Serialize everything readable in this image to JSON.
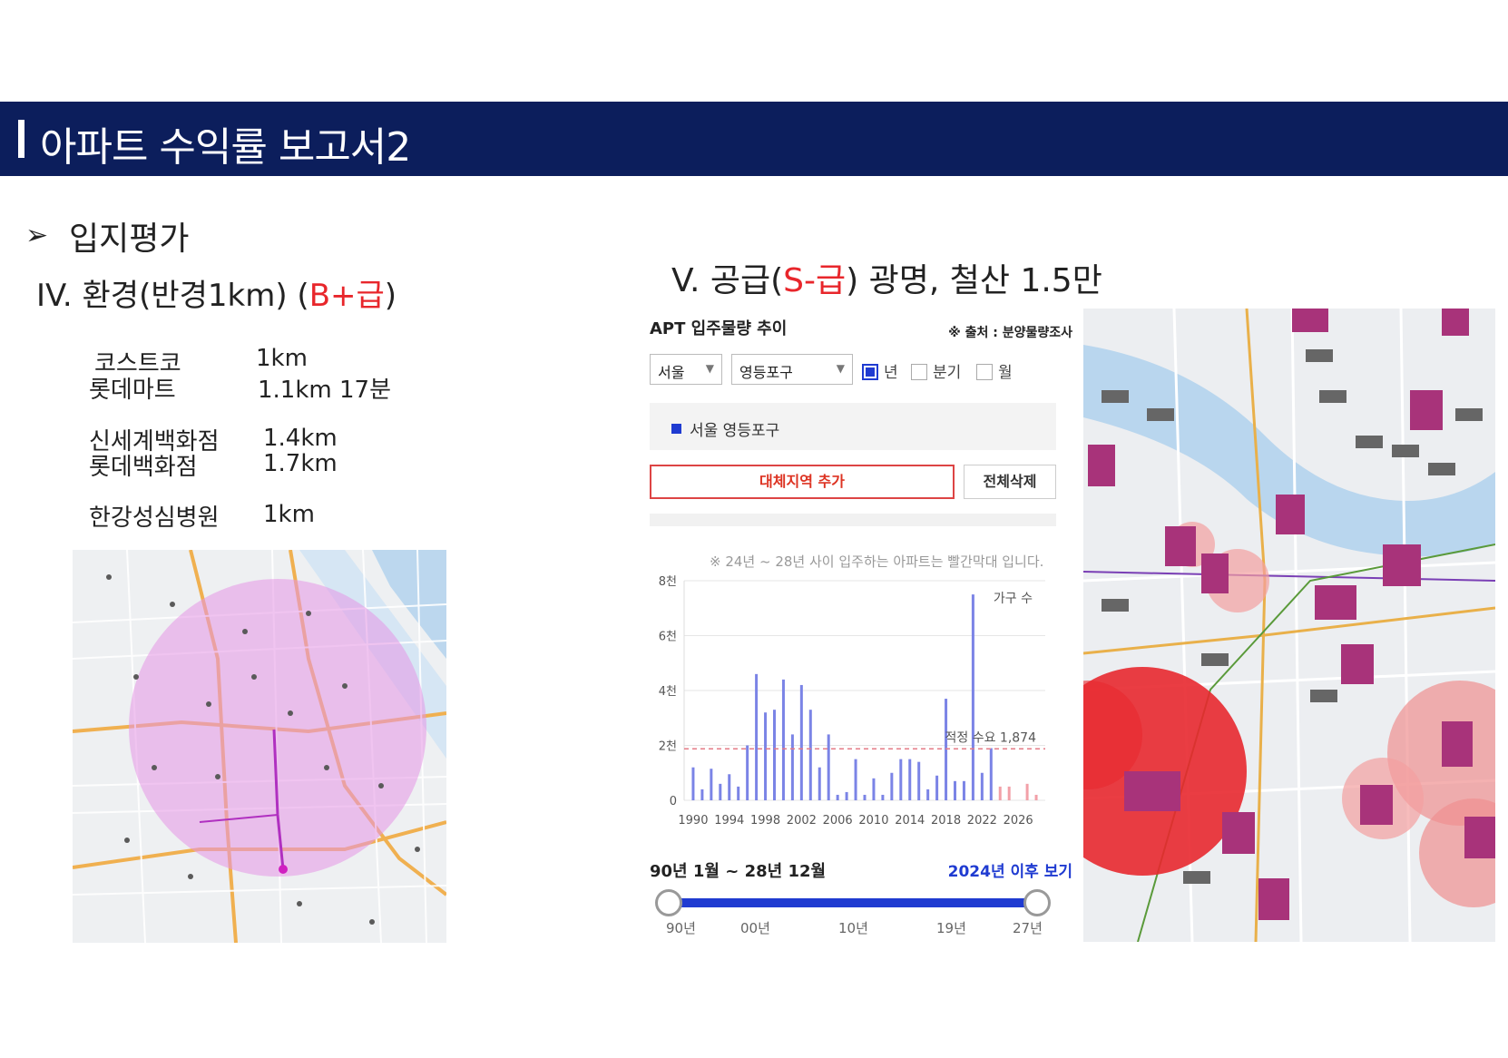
{
  "header": {
    "title": "아파트 수익률 보고서2"
  },
  "section": {
    "arrow": "➢",
    "label": "입지평가"
  },
  "left": {
    "heading_prefix": "IV.   환경(반경1km) (",
    "heading_grade": "B+급",
    "heading_suffix": ")",
    "facilities": [
      {
        "name": "코스트코",
        "distance": "1km"
      },
      {
        "name": "롯데마트",
        "distance": "1.1km 17분"
      },
      {
        "name": "신세계백화점",
        "distance": "1.4km"
      },
      {
        "name": "롯데백화점",
        "distance": "1.7km"
      },
      {
        "name": "한강성심병원",
        "distance": "1km"
      }
    ]
  },
  "right": {
    "heading_prefix": "V.    공급(",
    "heading_grade": "S-급",
    "heading_suffix": ") 광명, 철산 1.5만"
  },
  "panel": {
    "title": "APT 입주물량 추이",
    "source": "※ 출처 : 분양물량조사",
    "select_city": "서울",
    "select_district": "영등포구",
    "periods": [
      {
        "label": "년",
        "checked": true
      },
      {
        "label": "분기",
        "checked": false
      },
      {
        "label": "월",
        "checked": false
      }
    ],
    "region": "서울 영등포구",
    "add_button": "대체지역 추가",
    "delete_button": "전체삭제",
    "note": "※ 24년 ~ 28년 사이 입주하는 아파트는 빨간막대 입니다.",
    "range_label": "90년 1월 ~ 28년 12월",
    "range_link": "2024년 이후 보기",
    "slider_ticks": [
      "90년",
      "00년",
      "10년",
      "19년",
      "27년"
    ]
  },
  "chart_data": {
    "type": "bar",
    "legend": "가구 수",
    "y_ticks": [
      "0",
      "2천",
      "4천",
      "6천",
      "8천"
    ],
    "x_ticks": [
      "1990",
      "1994",
      "1998",
      "2002",
      "2006",
      "2010",
      "2014",
      "2018",
      "2022",
      "2026"
    ],
    "ylim": [
      0,
      8000
    ],
    "threshold_label": "적정 수요 1,874",
    "threshold": 1874,
    "x": [
      1990,
      1991,
      1992,
      1993,
      1994,
      1995,
      1996,
      1997,
      1998,
      1999,
      2000,
      2001,
      2002,
      2003,
      2004,
      2005,
      2006,
      2007,
      2008,
      2009,
      2010,
      2011,
      2012,
      2013,
      2014,
      2015,
      2016,
      2017,
      2018,
      2019,
      2020,
      2021,
      2022,
      2023,
      2024,
      2025,
      2026,
      2027,
      2028
    ],
    "values": [
      1200,
      400,
      1150,
      600,
      950,
      500,
      2000,
      4600,
      3200,
      3300,
      4400,
      2400,
      4200,
      3300,
      1200,
      2400,
      200,
      300,
      1500,
      200,
      800,
      200,
      1000,
      1500,
      1500,
      1400,
      400,
      900,
      3700,
      700,
      700,
      7500,
      1000,
      1900,
      500,
      500,
      0,
      600,
      200
    ],
    "highlight_from": 2024,
    "colors": {
      "bar": "#7b84e6",
      "highlight": "#f2a0a8",
      "threshold": "#e57b86"
    }
  },
  "maps": {
    "left_label": "영등포구 반경 1km 지도",
    "right_label": "입주물량 지도"
  }
}
